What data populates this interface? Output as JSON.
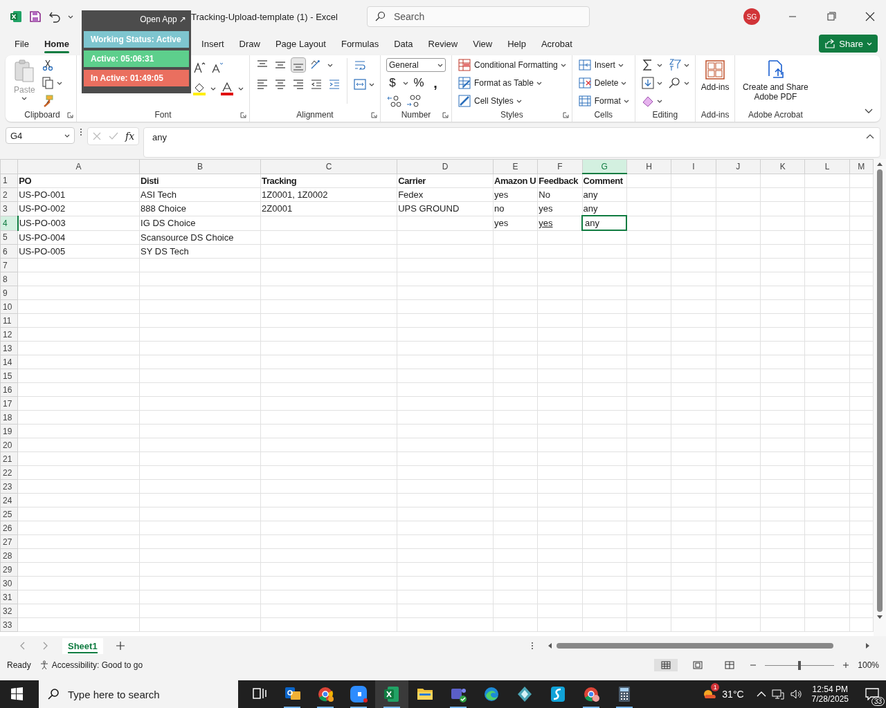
{
  "window": {
    "title": "Tracking-Upload-template (1)  -  Excel",
    "search_placeholder": "Search",
    "user_initials": "SG"
  },
  "overlay": {
    "link": "Open App ↗",
    "items": [
      {
        "text": "Working Status: Active",
        "color": "#7ec5cf"
      },
      {
        "text": "Active: 05:06:31",
        "color": "#5dcf8c"
      },
      {
        "text": "In Active: 01:49:05",
        "color": "#ea6f5f"
      }
    ]
  },
  "tabs": [
    {
      "label": "File",
      "selected": false
    },
    {
      "label": "Home",
      "selected": true
    },
    {
      "label": "Insert",
      "selected": false
    },
    {
      "label": "Draw",
      "selected": false
    },
    {
      "label": "Page Layout",
      "selected": false
    },
    {
      "label": "Formulas",
      "selected": false
    },
    {
      "label": "Data",
      "selected": false
    },
    {
      "label": "Review",
      "selected": false
    },
    {
      "label": "View",
      "selected": false
    },
    {
      "label": "Help",
      "selected": false
    },
    {
      "label": "Acrobat",
      "selected": false
    }
  ],
  "share_button": "Share",
  "ribbon": {
    "groups": [
      {
        "label": "Clipboard",
        "kind": "clipboard",
        "button": "Paste"
      },
      {
        "label": "Font",
        "kind": "font"
      },
      {
        "label": "Alignment",
        "kind": "alignment"
      },
      {
        "label": "Number",
        "kind": "number",
        "format": "General",
        "symbols": [
          "$",
          "%",
          ","
        ]
      },
      {
        "label": "Styles",
        "kind": "styles",
        "buttons": [
          "Conditional Formatting",
          "Format as Table",
          "Cell Styles"
        ]
      },
      {
        "label": "Cells",
        "kind": "cells",
        "buttons": [
          "Insert",
          "Delete",
          "Format"
        ]
      },
      {
        "label": "Editing",
        "kind": "editing"
      },
      {
        "label": "Add-ins",
        "kind": "addins",
        "button": "Add-ins"
      },
      {
        "label": "Adobe Acrobat",
        "kind": "acrobat",
        "button": "Create and Share Adobe PDF"
      }
    ]
  },
  "formula_bar": {
    "name_box": "G4",
    "function_button": "fx",
    "formula": "any"
  },
  "sheet": {
    "columns": [
      {
        "label": "A",
        "selected": false
      },
      {
        "label": "B",
        "selected": false
      },
      {
        "label": "C",
        "selected": false
      },
      {
        "label": "D",
        "selected": false
      },
      {
        "label": "E",
        "selected": false
      },
      {
        "label": "F",
        "selected": false
      },
      {
        "label": "G",
        "selected": true
      },
      {
        "label": "H",
        "selected": false
      },
      {
        "label": "I",
        "selected": false
      },
      {
        "label": "J",
        "selected": false
      },
      {
        "label": "K",
        "selected": false
      },
      {
        "label": "L",
        "selected": false
      },
      {
        "label": "M",
        "selected": false
      }
    ],
    "rows": [
      {
        "number": "1",
        "selected": false,
        "bold": true,
        "cells": [
          {
            "kind": "text",
            "text": "PO",
            "selected": false
          },
          {
            "kind": "text",
            "text": "Disti",
            "selected": false
          },
          {
            "kind": "text",
            "text": "Tracking",
            "selected": false
          },
          {
            "kind": "text",
            "text": "Carrier",
            "selected": false
          },
          {
            "kind": "text",
            "text": "Amazon U",
            "selected": false
          },
          {
            "kind": "text",
            "text": "Feedback",
            "selected": false
          },
          {
            "kind": "text",
            "text": "Comment",
            "selected": false
          }
        ]
      },
      {
        "number": "2",
        "selected": false,
        "bold": false,
        "cells": [
          {
            "kind": "text",
            "text": "US-PO-001",
            "selected": false
          },
          {
            "kind": "text",
            "text": "ASI Tech",
            "selected": false
          },
          {
            "kind": "text",
            "text": "1Z0001, 1Z0002",
            "selected": false
          },
          {
            "kind": "text",
            "text": "Fedex",
            "selected": false
          },
          {
            "kind": "text",
            "text": "yes",
            "selected": false
          },
          {
            "kind": "text",
            "text": "No",
            "selected": false
          },
          {
            "kind": "text",
            "text": "any",
            "selected": false
          }
        ]
      },
      {
        "number": "3",
        "selected": false,
        "bold": false,
        "cells": [
          {
            "kind": "text",
            "text": "US-PO-002",
            "selected": false
          },
          {
            "kind": "text",
            "text": "888 Choice",
            "selected": false
          },
          {
            "kind": "text",
            "text": "2Z0001",
            "selected": false
          },
          {
            "kind": "text",
            "text": "UPS GROUND",
            "selected": false
          },
          {
            "kind": "text",
            "text": "no",
            "selected": false
          },
          {
            "kind": "text",
            "text": "yes",
            "selected": false
          },
          {
            "kind": "text",
            "text": "any",
            "selected": false
          }
        ]
      },
      {
        "number": "4",
        "selected": true,
        "bold": false,
        "cells": [
          {
            "kind": "text",
            "text": "US-PO-003",
            "selected": false
          },
          {
            "kind": "text",
            "text": "IG DS Choice",
            "selected": false
          },
          {
            "kind": "empty",
            "selected": false
          },
          {
            "kind": "empty",
            "selected": false
          },
          {
            "kind": "text",
            "text": "yes",
            "selected": false
          },
          {
            "kind": "text",
            "text": "yes",
            "selected": false,
            "underlined": true
          },
          {
            "kind": "text",
            "text": "any",
            "selected": true
          }
        ]
      },
      {
        "number": "5",
        "selected": false,
        "bold": false,
        "cells": [
          {
            "kind": "text",
            "text": "US-PO-004",
            "selected": false
          },
          {
            "kind": "text",
            "text": "Scansource DS Choice",
            "selected": false
          }
        ]
      },
      {
        "number": "6",
        "selected": false,
        "bold": false,
        "cells": [
          {
            "kind": "text",
            "text": "US-PO-005",
            "selected": false
          },
          {
            "kind": "text",
            "text": "SY DS Tech",
            "selected": false
          }
        ]
      },
      {
        "number": "7"
      },
      {
        "number": "8"
      },
      {
        "number": "9"
      },
      {
        "number": "10"
      },
      {
        "number": "11"
      },
      {
        "number": "12"
      },
      {
        "number": "13"
      },
      {
        "number": "14"
      },
      {
        "number": "15"
      },
      {
        "number": "16"
      },
      {
        "number": "17"
      },
      {
        "number": "18"
      },
      {
        "number": "19"
      },
      {
        "number": "20"
      },
      {
        "number": "21"
      },
      {
        "number": "22"
      },
      {
        "number": "23"
      },
      {
        "number": "24"
      },
      {
        "number": "25"
      },
      {
        "number": "26"
      },
      {
        "number": "27"
      },
      {
        "number": "28"
      },
      {
        "number": "29"
      },
      {
        "number": "30"
      },
      {
        "number": "31"
      },
      {
        "number": "32"
      },
      {
        "number": "33"
      }
    ]
  },
  "sheet_tabs": [
    {
      "label": "Sheet1",
      "selected": true
    }
  ],
  "status_bar": {
    "status": "Ready",
    "accessibility": "Accessibility: Good to go",
    "zoom": {
      "level": 0.5,
      "reading": "100%"
    }
  },
  "taskbar": {
    "search_placeholder": "Type here to search",
    "weather_badge": "1",
    "temperature": "31°C",
    "time": "12:54 PM",
    "date": "7/28/2025",
    "notifications": "33"
  }
}
